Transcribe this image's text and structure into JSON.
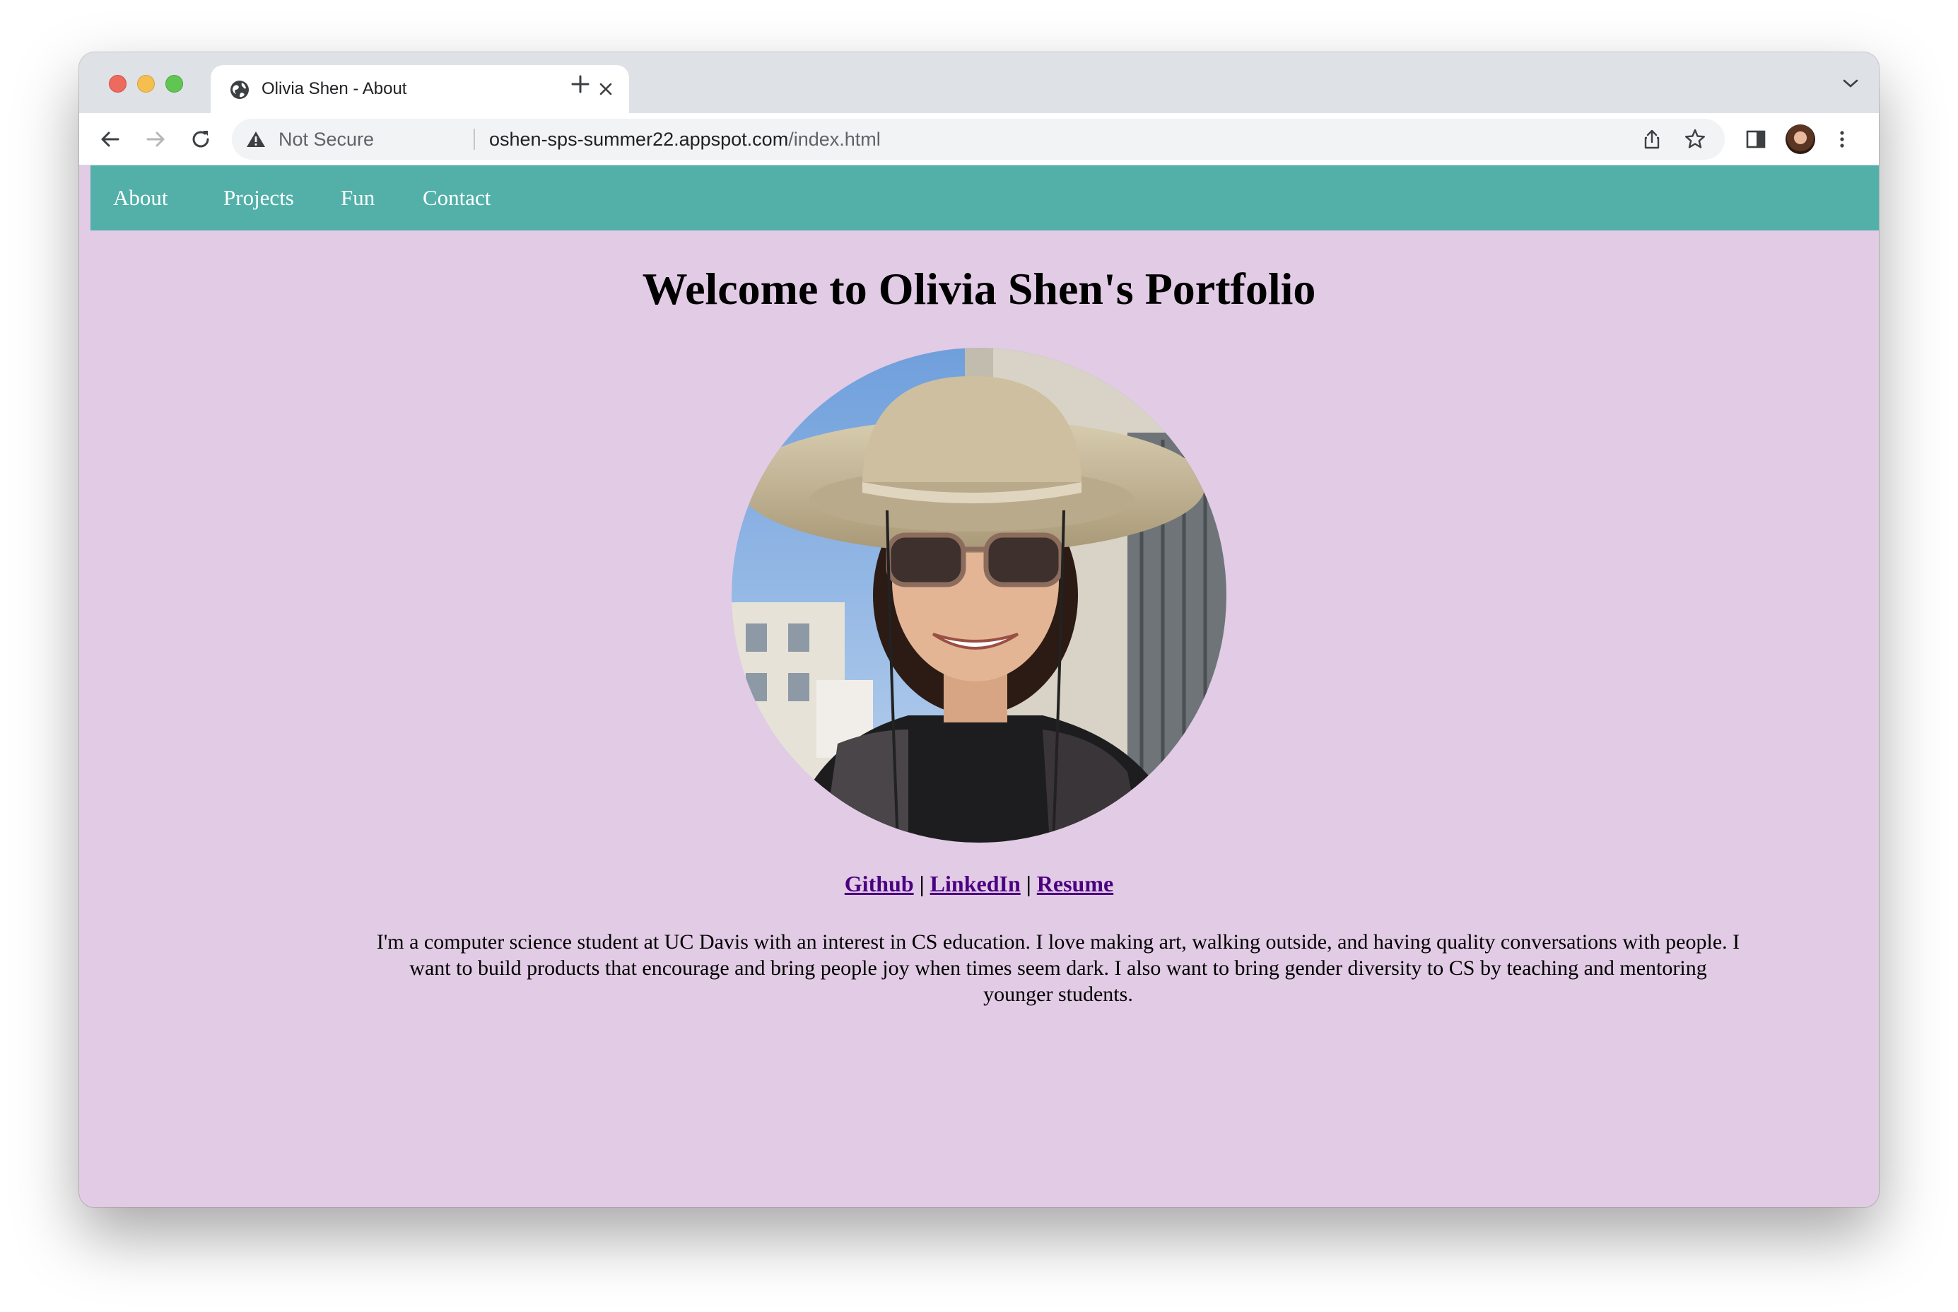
{
  "browser": {
    "tab_title": "Olivia Shen - About",
    "security_label": "Not Secure",
    "url_host": "oshen-sps-summer22.appspot.com",
    "url_path": "/index.html"
  },
  "nav": {
    "items": [
      "About",
      "Projects",
      "Fun",
      "Contact"
    ]
  },
  "main": {
    "heading": "Welcome to Olivia Shen's Portfolio",
    "links": [
      "Github",
      "LinkedIn",
      "Resume"
    ],
    "separator": "|",
    "bio": "I'm a computer science student at UC Davis with an interest in CS education. I love making art, walking outside, and having quality conversations with people. I want to build products that encourage and bring people joy when times seem dark. I also want to bring gender diversity to CS by teaching and mentoring younger students."
  },
  "colors": {
    "page_background": "#e2cbe5",
    "navbar": "#52b0a8",
    "link": "#4b0082"
  }
}
